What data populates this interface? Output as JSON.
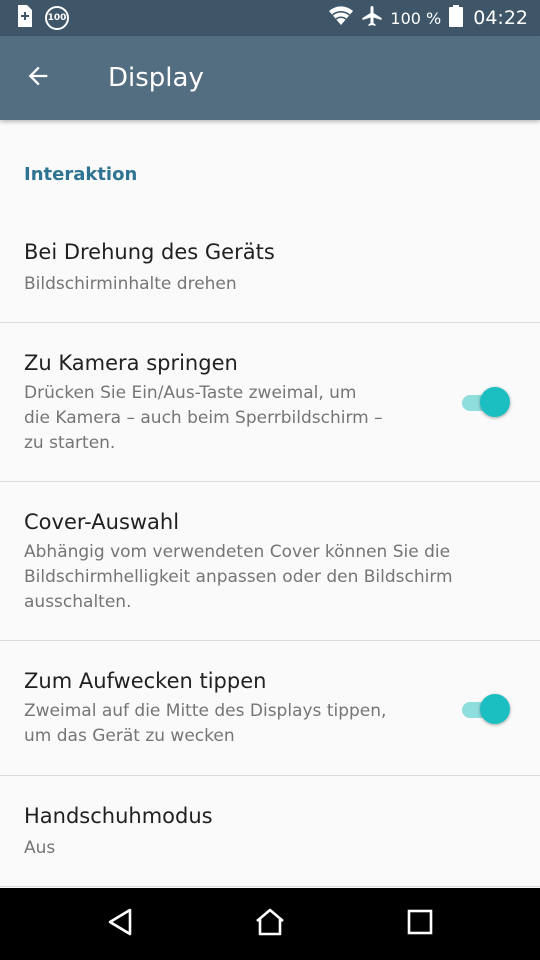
{
  "status_bar": {
    "left_icons": [
      "sim-plus-icon",
      "battery-100-badge-icon"
    ],
    "badge_text": "100",
    "right_icons": [
      "wifi-icon",
      "airplane-mode-icon",
      "battery-full-icon"
    ],
    "battery_percent": "100 %",
    "time": "04:22"
  },
  "toolbar": {
    "back_icon": "arrow-back-icon",
    "title": "Display"
  },
  "section": {
    "header": "Interaktion"
  },
  "items": [
    {
      "title": "Bei Drehung des Geräts",
      "summary": "Bildschirminhalte drehen"
    },
    {
      "title": "Zu Kamera springen",
      "summary_lines": [
        "Drücken Sie Ein/Aus-Taste zweimal, um",
        "die Kamera – auch beim Sperrbildschirm –",
        "zu starten."
      ],
      "switch_on": true
    },
    {
      "title": "Cover-Auswahl",
      "summary_lines": [
        "Abhängig vom verwendeten Cover können Sie die",
        "Bildschirmhelligkeit anpassen oder den Bildschirm",
        "ausschalten."
      ]
    },
    {
      "title": "Zum Aufwecken tippen",
      "summary_lines": [
        "Zweimal auf die Mitte des Displays tippen,",
        "um das Gerät zu wecken"
      ],
      "switch_on": true
    },
    {
      "title": "Handschuhmodus",
      "summary": "Aus"
    }
  ],
  "nav_bar": {
    "icons": [
      "back-triangle-icon",
      "home-icon",
      "recents-square-icon"
    ]
  },
  "colors": {
    "status_bar": "#3e5668",
    "toolbar": "#546e81",
    "accent": "#2f7393",
    "switch_thumb": "#1bbfc2",
    "switch_track": "#8fdede"
  }
}
